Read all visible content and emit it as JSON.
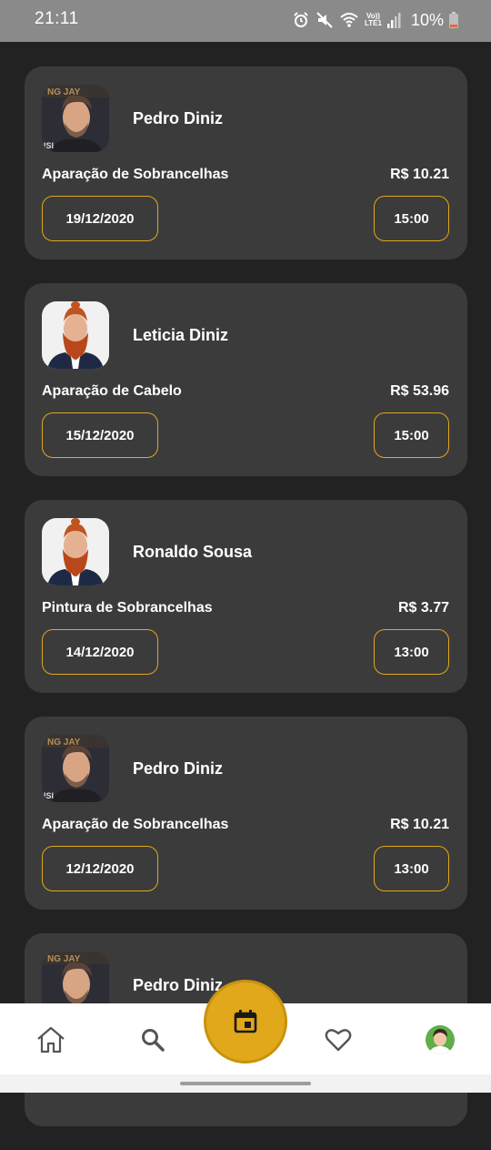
{
  "status_bar": {
    "time": "21:11",
    "network_top": "Vo))",
    "network_bottom": "LTE1",
    "battery": "10%"
  },
  "appointments": [
    {
      "name": "Pedro Diniz",
      "service": "Aparação de Sobrancelhas",
      "price": "R$ 10.21",
      "date": "19/12/2020",
      "time": "15:00",
      "avatar": "man-short-hair-photo"
    },
    {
      "name": "Leticia Diniz",
      "service": "Aparação de Cabelo",
      "price": "R$ 53.96",
      "date": "15/12/2020",
      "time": "15:00",
      "avatar": "red-beard-man-photo"
    },
    {
      "name": "Ronaldo Sousa",
      "service": "Pintura de Sobrancelhas",
      "price": "R$ 3.77",
      "date": "14/12/2020",
      "time": "13:00",
      "avatar": "red-beard-man-photo"
    },
    {
      "name": "Pedro Diniz",
      "service": "Aparação de Sobrancelhas",
      "price": "R$ 10.21",
      "date": "12/12/2020",
      "time": "13:00",
      "avatar": "man-short-hair-photo"
    },
    {
      "name": "Pedro Diniz",
      "service": "",
      "price": "",
      "date": "",
      "time": "",
      "avatar": "man-short-hair-photo"
    }
  ],
  "bottom_nav": {
    "items": [
      {
        "icon": "home-icon"
      },
      {
        "icon": "search-icon"
      },
      {
        "icon": "calendar-icon",
        "active": true
      },
      {
        "icon": "heart-icon"
      },
      {
        "icon": "profile-avatar"
      }
    ]
  },
  "colors": {
    "background": "#222222",
    "card": "#3b3b3b",
    "accent": "#e0a81a",
    "status_bar": "#8a8a8a"
  }
}
